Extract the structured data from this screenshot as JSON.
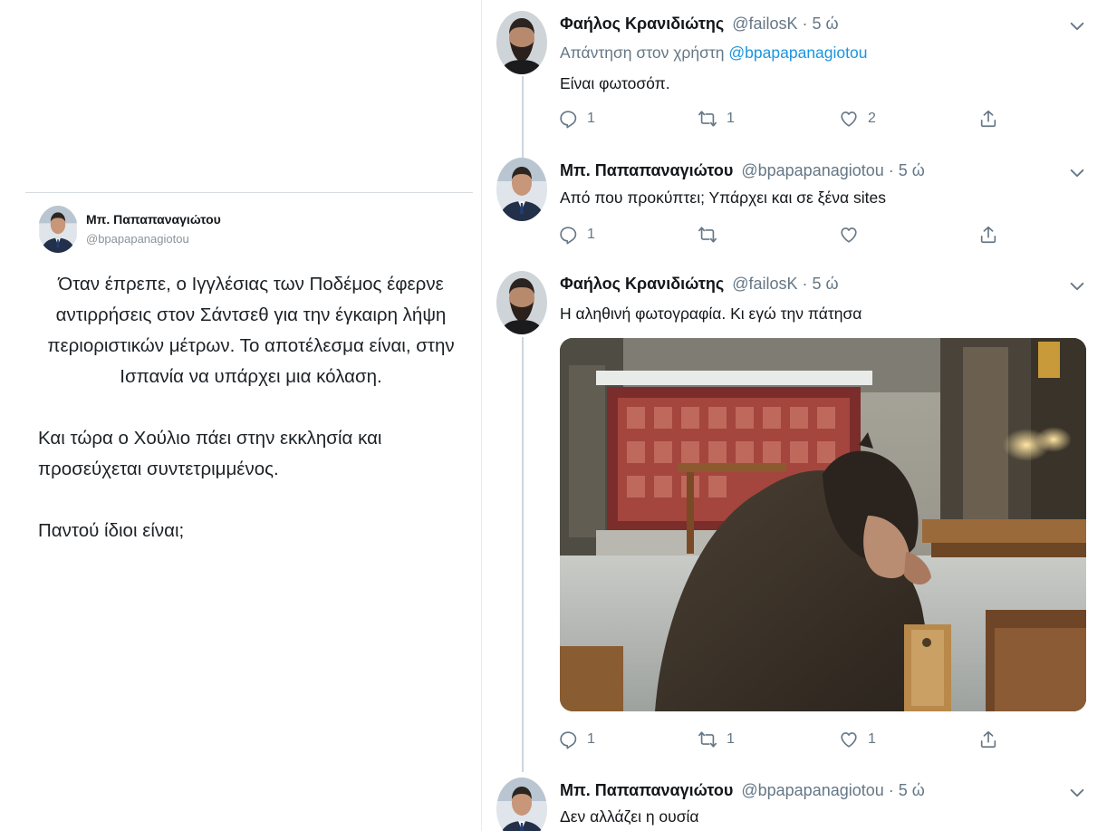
{
  "left_tweet": {
    "author_name": "Μπ. Παπαπαναγιώτου",
    "author_handle": "@bpapapanagiotou",
    "paragraphs": [
      "Όταν έπρεπε, ο Ιγγλέσιας των Ποδέμος έφερνε αντιρρήσεις στον Σάντσεθ για την έγκαιρη λήψη περιοριστικών μέτρων. Το αποτέλεσμα είναι, στην Ισπανία να υπάρχει μια κόλαση.",
      "Και τώρα ο Χούλιο πάει στην εκκλησία και προσεύχεται συντετριμμένος.",
      "Παντού ίδιοι είναι;"
    ]
  },
  "thread": [
    {
      "author_name": "Φαήλος Κρανιδιώτης",
      "meta": "@failosK · 5 ώ",
      "reply_label": "Απάντηση στον χρήστη",
      "reply_mention": "@bpapapanagiotou",
      "text": "Είναι φωτοσόπ.",
      "replies": "1",
      "retweets": "1",
      "likes": "2"
    },
    {
      "author_name": "Μπ. Παπαπαναγιώτου",
      "meta": "@bpapapanagiotou · 5 ώ",
      "text": "Από που προκύπτει; Υπάρχει και σε ξένα sites",
      "replies": "1",
      "retweets": "",
      "likes": ""
    },
    {
      "author_name": "Φαήλος Κρανιδιώτης",
      "meta": "@failosK · 5 ώ",
      "text": "Η αληθινή φωτογραφία. Κι εγώ την πάτησα",
      "replies": "1",
      "retweets": "1",
      "likes": "1"
    },
    {
      "author_name": "Μπ. Παπαπαναγιώτου",
      "meta": "@bpapapanagiotou · 5 ώ",
      "text": "Δεν αλλάζει η ουσία"
    }
  ],
  "colors": {
    "accent": "#1b95e0",
    "muted": "#657786",
    "text": "#14171a"
  },
  "icons": [
    "reply-icon",
    "retweet-icon",
    "like-icon",
    "share-icon",
    "chevron-down-icon"
  ]
}
